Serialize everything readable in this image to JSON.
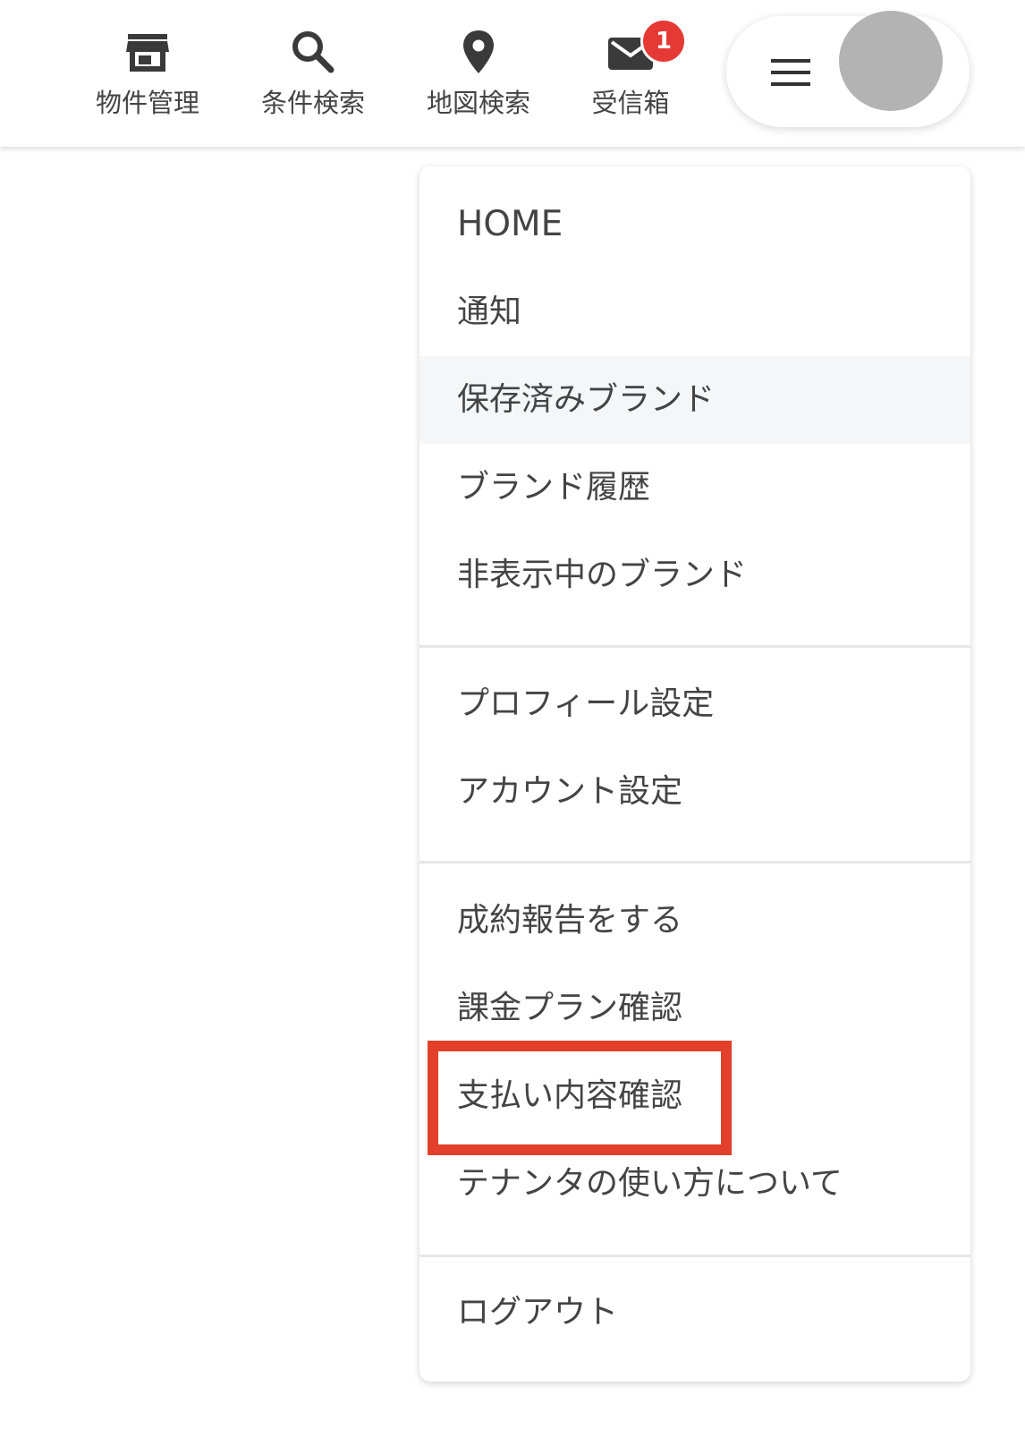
{
  "nav": {
    "items": [
      {
        "label": "物件管理",
        "icon": "storefront-icon"
      },
      {
        "label": "条件検索",
        "icon": "search-icon"
      },
      {
        "label": "地図検索",
        "icon": "location-pin-icon"
      },
      {
        "label": "受信箱",
        "icon": "mail-icon",
        "badge": "1"
      }
    ]
  },
  "user_menu": {
    "menu_icon": "hamburger-icon",
    "avatar": "avatar"
  },
  "menu": {
    "items": [
      {
        "label": "HOME"
      },
      {
        "label": "通知"
      },
      {
        "label": "保存済みブランド"
      },
      {
        "label": "ブランド履歴"
      },
      {
        "label": "非表示中のブランド"
      },
      {
        "label": "プロフィール設定"
      },
      {
        "label": "アカウント設定"
      },
      {
        "label": "成約報告をする"
      },
      {
        "label": "課金プラン確認"
      },
      {
        "label": "支払い内容確認"
      },
      {
        "label": "テナンタの使い方について"
      },
      {
        "label": "ログアウト"
      }
    ]
  },
  "colors": {
    "highlight": "#e2402a",
    "badge": "#e53935",
    "hover": "#f5f6f8",
    "avatar": "#b3b3b3"
  }
}
